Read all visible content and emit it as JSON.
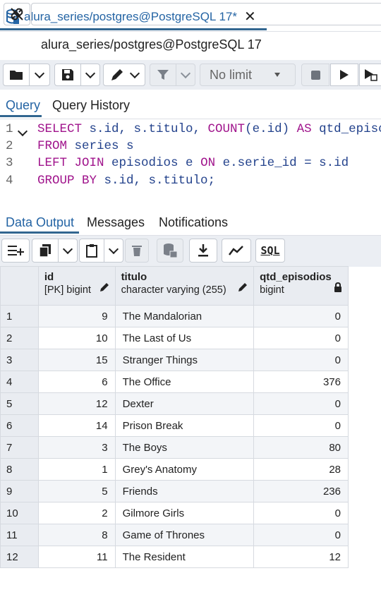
{
  "tab": {
    "title": "alura_series/postgres@PostgreSQL 17*",
    "close": "✕"
  },
  "connection": {
    "label": "alura_series/postgres@PostgreSQL 17"
  },
  "toolbar": {
    "limit": "No limit"
  },
  "editor_tabs": [
    "Query",
    "Query History"
  ],
  "sql_lines": [
    [
      [
        "kw",
        "SELECT "
      ],
      [
        "id",
        "s.id, s.titulo, "
      ],
      [
        "fn",
        "COUNT"
      ],
      [
        "id",
        "(e.id) "
      ],
      [
        "kw",
        "AS "
      ],
      [
        "id",
        "qtd_episo"
      ]
    ],
    [
      [
        "kw",
        "FROM "
      ],
      [
        "id",
        "series s"
      ]
    ],
    [
      [
        "kw",
        "LEFT JOIN "
      ],
      [
        "id",
        "episodios e "
      ],
      [
        "kw",
        "ON "
      ],
      [
        "id",
        "e.serie_id = s.id"
      ]
    ],
    [
      [
        "kw",
        "GROUP BY "
      ],
      [
        "id",
        "s.id, s.titulo;"
      ]
    ]
  ],
  "line_numbers": [
    "1",
    "2",
    "3",
    "4"
  ],
  "output_tabs": [
    "Data Output",
    "Messages",
    "Notifications"
  ],
  "sql_button": "SQL",
  "columns": [
    {
      "name": "id",
      "type": "[PK] bigint"
    },
    {
      "name": "titulo",
      "type": "character varying (255)"
    },
    {
      "name": "qtd_episodios",
      "type": "bigint"
    }
  ],
  "rows": [
    [
      "1",
      "9",
      "The Mandalorian",
      "0"
    ],
    [
      "2",
      "10",
      "The Last of Us",
      "0"
    ],
    [
      "3",
      "15",
      "Stranger Things",
      "0"
    ],
    [
      "4",
      "6",
      "The Office",
      "376"
    ],
    [
      "5",
      "12",
      "Dexter",
      "0"
    ],
    [
      "6",
      "14",
      "Prison Break",
      "0"
    ],
    [
      "7",
      "3",
      "The Boys",
      "80"
    ],
    [
      "8",
      "1",
      "Grey's Anatomy",
      "28"
    ],
    [
      "9",
      "5",
      "Friends",
      "236"
    ],
    [
      "10",
      "2",
      "Gilmore Girls",
      "0"
    ],
    [
      "11",
      "8",
      "Game of Thrones",
      "0"
    ],
    [
      "12",
      "11",
      "The Resident",
      "12"
    ]
  ]
}
